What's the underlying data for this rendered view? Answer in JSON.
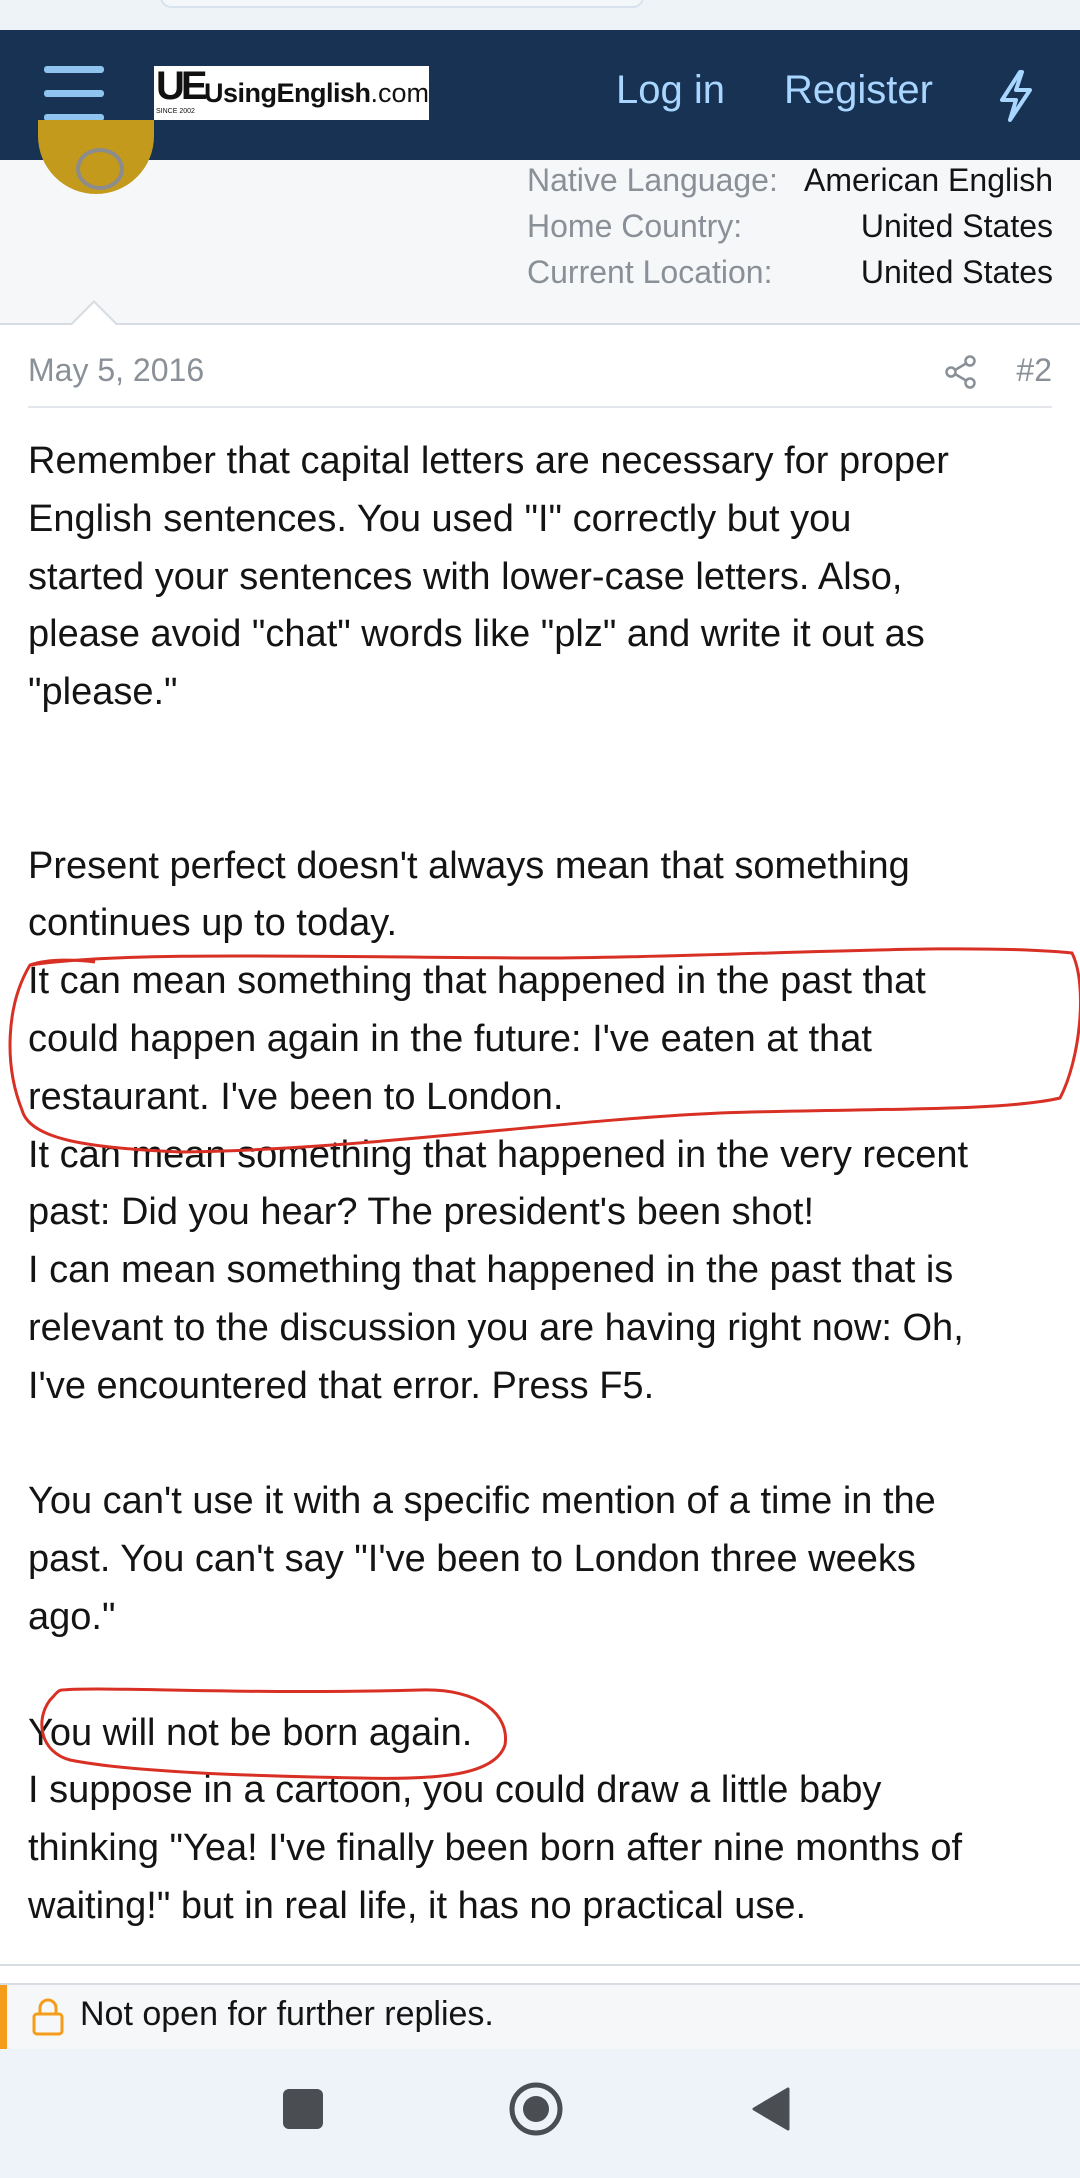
{
  "header": {
    "logo_ue": "UE",
    "logo_word": "UsingEnglish",
    "logo_tld": ".com",
    "logo_since": "SINCE 2002",
    "login_label": "Log in",
    "register_label": "Register",
    "colors": {
      "bar": "#183254",
      "link": "#a9d6ff"
    }
  },
  "profile": {
    "rows": [
      {
        "key": "Native Language:",
        "value": "American English"
      },
      {
        "key": "Home Country:",
        "value": "United States"
      },
      {
        "key": "Current Location:",
        "value": "United States"
      }
    ]
  },
  "post": {
    "date": "May 5, 2016",
    "number": "#2",
    "share_icon": "share-icon",
    "paragraphs": [
      "Remember that capital letters are necessary for proper",
      "English sentences. You used \"I\" correctly but you",
      "started your sentences with lower-case letters. Also,",
      "please avoid \"chat\" words like \"plz\" and write it out as",
      "\"please.\"",
      "",
      "",
      "Present perfect doesn't always mean that something",
      "continues up to today.",
      "It can mean something that happened in the past that",
      "could happen again in the future: I've eaten at that",
      "restaurant. I've been to London.",
      "It can mean something that happened in the very recent",
      "past: Did you hear? The president's been shot!",
      "I can mean something that happened in the past that is",
      "relevant to the discussion you are having right now: Oh,",
      "I've encountered that error. Press F5.",
      "",
      "You can't use it with a specific mention of a time in the",
      "past. You can't say \"I've been to London three weeks",
      "ago.\"",
      "",
      "You will not be born again.",
      "I suppose in a cartoon, you could draw a little baby",
      "thinking \"Yea! I've finally been born after nine months of",
      "waiting!\" but in real life, it has no practical use."
    ],
    "annotation_color": "#d93025"
  },
  "notice": {
    "icon": "lock-icon",
    "text": "Not open for further replies.",
    "accent": "#f59c1a"
  },
  "system_nav": {
    "recents_icon": "square-icon",
    "home_icon": "circle-home-icon",
    "back_icon": "triangle-back-icon"
  }
}
